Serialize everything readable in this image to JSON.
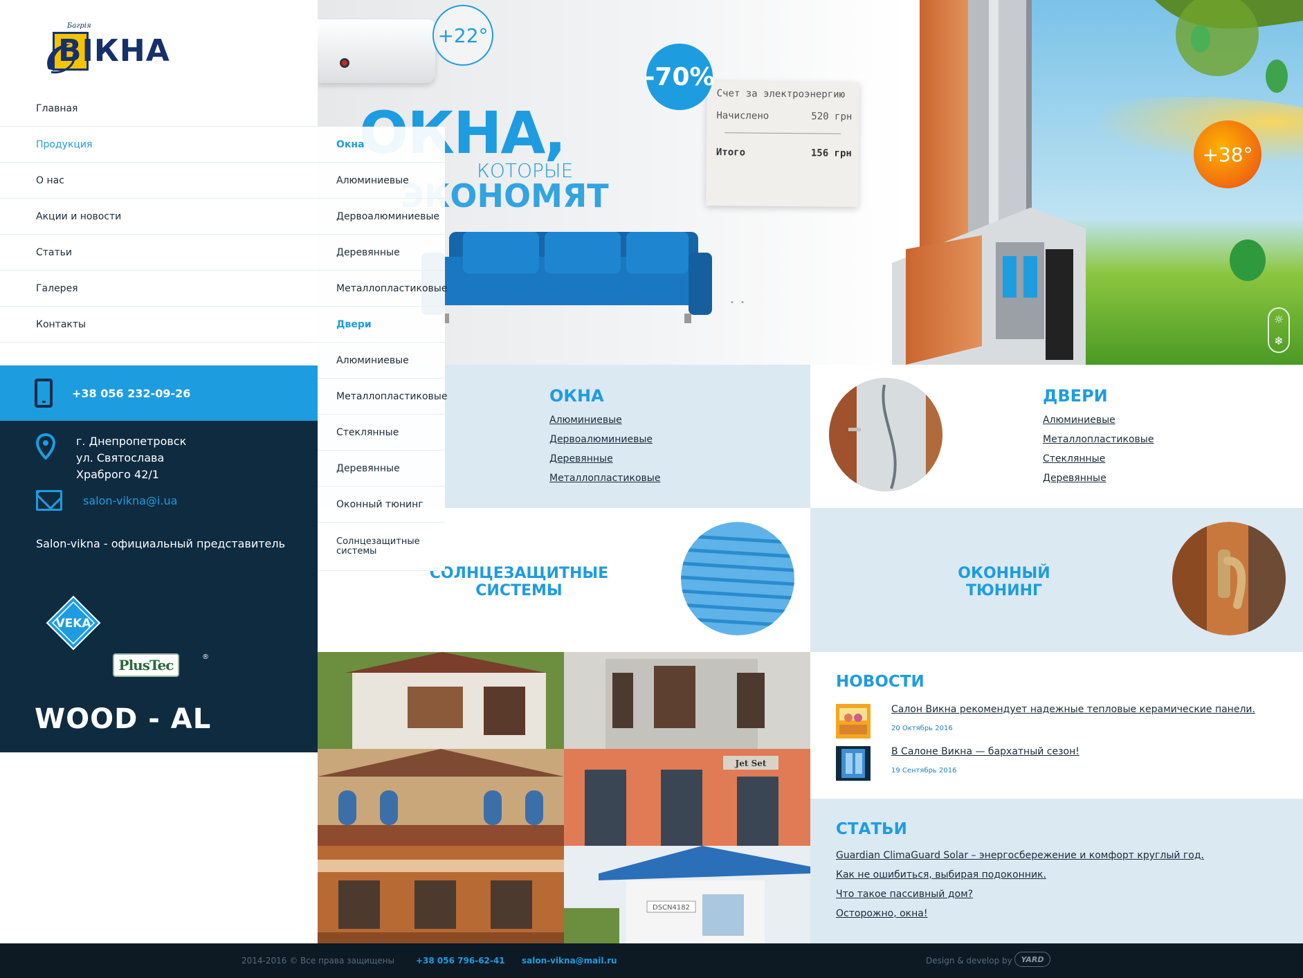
{
  "brand": {
    "name": "ВІКНА",
    "small": "Багрія"
  },
  "nav": {
    "items": [
      {
        "label": "Главная"
      },
      {
        "label": "Продукция"
      },
      {
        "label": "О нас"
      },
      {
        "label": "Акции и новости"
      },
      {
        "label": "Статьи"
      },
      {
        "label": "Галерея"
      },
      {
        "label": "Контакты"
      }
    ]
  },
  "submenu": {
    "items": [
      "Окна",
      "Алюминиевые",
      "Дервоалюминиевые",
      "Деревянные",
      "Металлопластиковые",
      "Двери",
      "Алюминиевые",
      "Металлопластиковые",
      "Стеклянные",
      "Деревянные",
      "Оконный тюнинг",
      "Солнцезащитные системы"
    ]
  },
  "contact": {
    "phone": "+38 056 232-09-26",
    "address_line1": "г. Днепропетровск",
    "address_line2": "ул. Святослава",
    "address_line3": "Храброго 42/1",
    "email": "salon-vikna@i.ua",
    "representative": "Salon-vikna - официальный представитель"
  },
  "partners": {
    "veka": "VEKA",
    "plustec": "PlusTec",
    "plustec_mark": "®",
    "wood_al": "WOOD - AL"
  },
  "hero": {
    "temp_cold": "+22°",
    "temp_hot": "+38°",
    "discount": "-70%",
    "slogan_line1": "ОКНА,",
    "slogan_line2": "КОТОРЫЕ",
    "slogan_line3": "ЭКОНОМЯТ",
    "receipt_title": "Счет за электроэнергию",
    "receipt_charged_label": "Начислено",
    "receipt_charged_value": "520 грн",
    "receipt_total_label": "Итого",
    "receipt_total_value": "156 грн",
    "sun_symbol": "☼",
    "snow_symbol": "❄",
    "dots": "• •"
  },
  "tiles": {
    "windows": {
      "title": "ОКНА",
      "links": [
        "Алюминиевые",
        "Дервоалюминиевые",
        "Деревянные",
        "Металлопластиковые"
      ]
    },
    "doors": {
      "title": "ДВЕРИ",
      "links": [
        "Алюминиевые",
        "Металлопластиковые",
        "Стеклянные",
        "Деревянные"
      ]
    },
    "sun": {
      "line1": "СОЛНЦЕЗАЩИТНЫЕ",
      "line2": "СИСТЕМЫ"
    },
    "tuning": {
      "line1": "ОКОННЫЙ",
      "line2": "ТЮНИНГ"
    }
  },
  "news": {
    "title": "НОВОСТИ",
    "items": [
      {
        "title": "Салон Викна рекомендует надежные тепловые керамические панели.",
        "date": "20 Октябрь 2016"
      },
      {
        "title": "В Салоне Викна — бархатный сезон!",
        "date": "19 Сентябрь 2016"
      }
    ]
  },
  "articles": {
    "title": "СТАТЬИ",
    "items": [
      "Guardian ClimaGuard Solar – энергосбережение и комфорт круглый год.",
      "Как не ошибиться, выбирая подоконник.",
      "Что такое пассивный дом?",
      "Осторожно, окна!"
    ]
  },
  "gallery": {
    "sign": "Jet Set",
    "watermark": "DSCN4182"
  },
  "footer": {
    "copyright": "2014-2016 © Все права защищены",
    "phone": "+38 056 796-62-41",
    "email": "salon-vikna@mail.ru",
    "design_by": "Design & develop by",
    "studio": "YARD"
  },
  "colors": {
    "accent": "#1e9ce0",
    "dark": "#0f2b40",
    "light_panel": "#dbe9f3",
    "footer": "#0d1a24"
  }
}
